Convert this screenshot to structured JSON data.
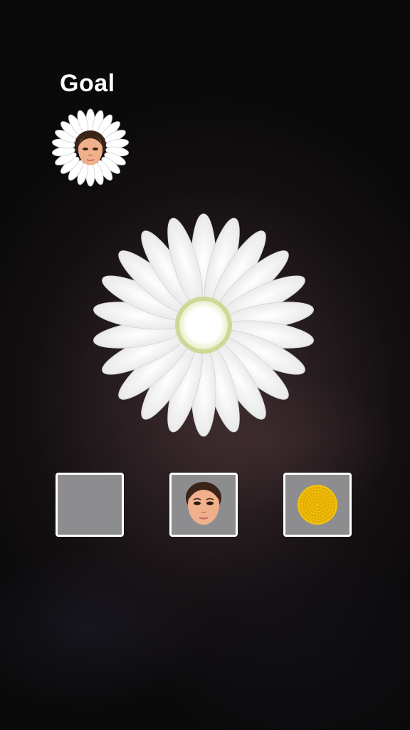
{
  "goal": {
    "title": "Goal",
    "target": [
      "petals",
      "face"
    ]
  },
  "flower": {
    "petal_color": "#ffffff",
    "center_color": "#ffffff",
    "center_ring_color": "#c9d58a"
  },
  "choices": [
    {
      "icon": "blank-tile-icon"
    },
    {
      "icon": "face-icon"
    },
    {
      "icon": "yellow-flower-center-icon"
    }
  ]
}
